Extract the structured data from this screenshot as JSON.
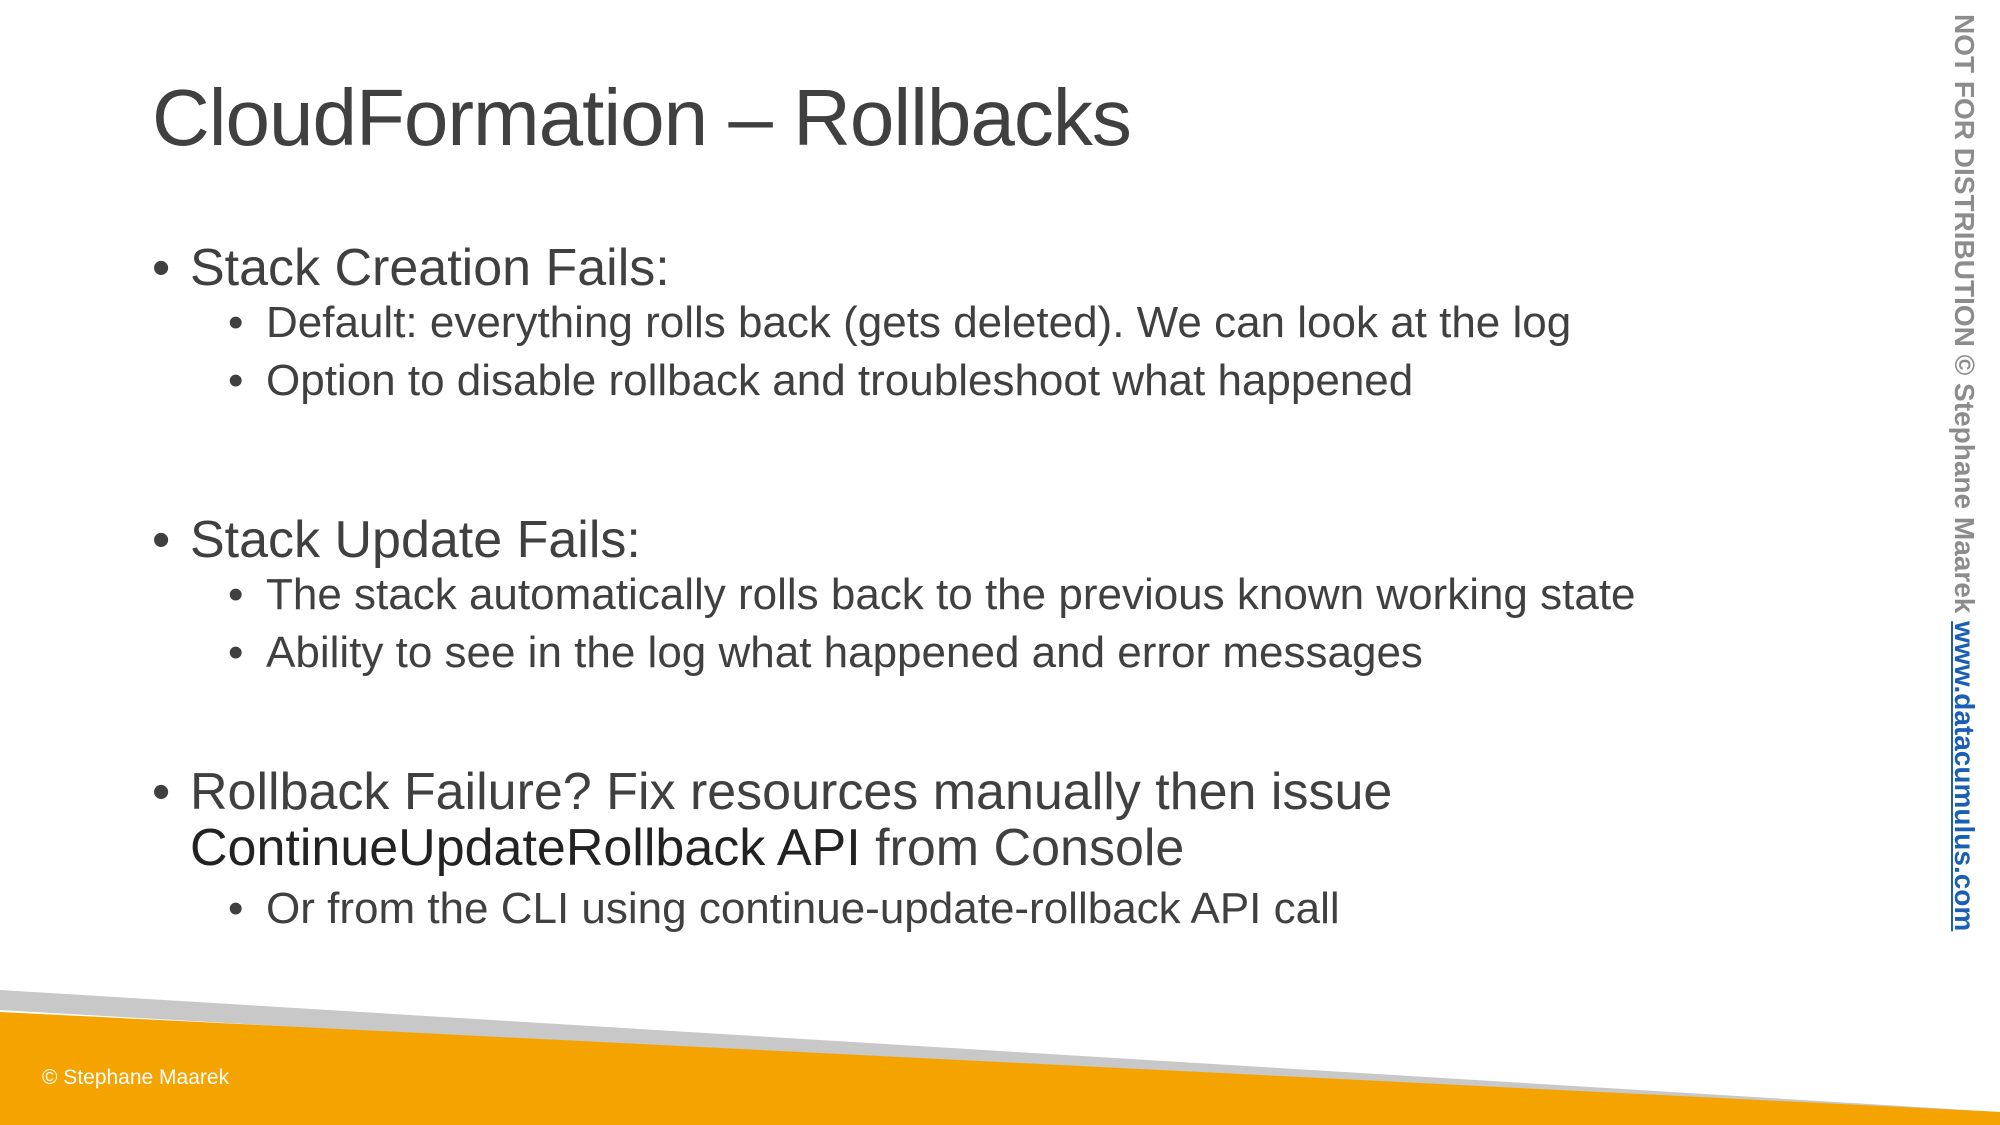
{
  "slide": {
    "title": "CloudFormation – Rollbacks",
    "bullets": {
      "b1": "Stack Creation Fails:",
      "b1_1": "Default: everything rolls back (gets deleted). We can look at the log",
      "b1_2": "Option to disable rollback and troubleshoot what happened",
      "b2": "Stack Update Fails:",
      "b2_1": "The stack automatically rolls back to the previous known working state",
      "b2_2": "Ability to see in the log what happened and error messages",
      "b3": "Rollback Failure? Fix resources manually then issue",
      "b3_emph": "ContinueUpdateRollback API",
      "b3_tail": " from Console",
      "b3_1": "Or from the CLI using continue-update-rollback API call"
    },
    "bullet_char": "•"
  },
  "footer": {
    "copyright": "© Stephane Maarek"
  },
  "side": {
    "notice": "NOT FOR DISTRIBUTION © Stephane Maarek ",
    "link": "www.datacumulus.com"
  },
  "colors": {
    "banner_orange": "#f5a300",
    "banner_gray": "#c8c8c8",
    "text": "#404040",
    "link": "#1a5fb4"
  }
}
